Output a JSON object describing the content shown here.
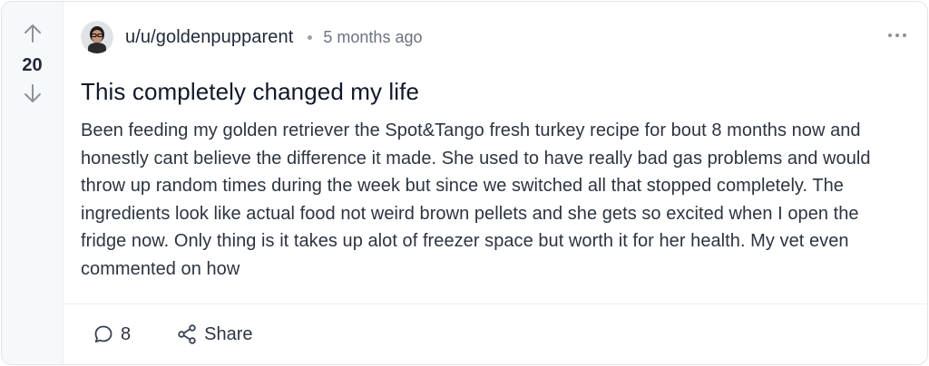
{
  "vote": {
    "count": "20",
    "upvote_icon": "arrow-up-icon",
    "downvote_icon": "arrow-down-icon"
  },
  "post": {
    "username": "u/u/goldenpupparent",
    "timestamp": "5 months ago",
    "title": "This completely changed my life",
    "body": "Been feeding my golden retriever the Spot&Tango fresh turkey recipe for bout 8 months now and honestly cant believe the difference it made. She used to have really bad gas problems and would throw up random times during the week but since we switched all that stopped completely. The ingredients look like actual food not weird brown pellets and she gets so excited when I open the fridge now. Only thing is it takes up alot of freezer space but worth it for her health. My vet even commented on how",
    "more_icon": "more-horizontal-icon"
  },
  "footer": {
    "comments_count": "8",
    "comments_icon": "comment-icon",
    "share_label": "Share",
    "share_icon": "share-icon"
  },
  "colors": {
    "vote_column_bg": "#f7f8f9",
    "border": "#e2e4e8",
    "text_primary": "#1f2937",
    "text_secondary": "#6b7280"
  }
}
